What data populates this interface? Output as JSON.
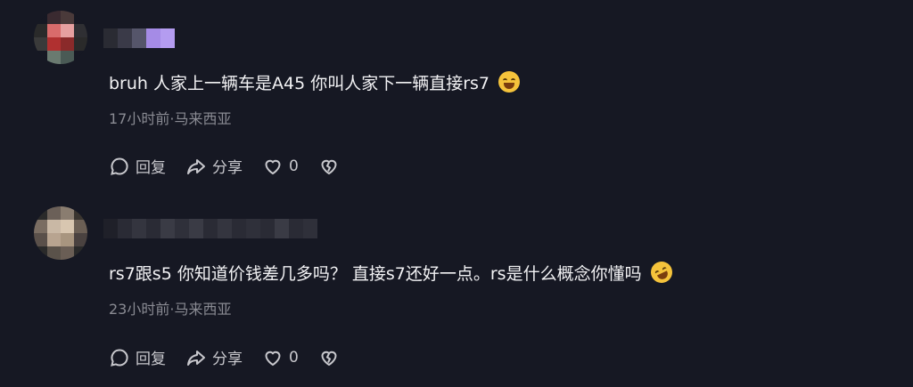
{
  "comments": [
    {
      "text": "bruh 人家上一辆车是A45 你叫人家下一辆直接rs7",
      "emoji": "crying-laughing-emoji",
      "meta": "17小时前·马来西亚",
      "actions": {
        "reply": "回复",
        "share": "分享",
        "likes": "0"
      },
      "avatar_colors": [
        "#161823",
        "#3a2a30",
        "#4a3a3a",
        "#161823",
        "#2a2a2a",
        "#d96b6b",
        "#e6a0a0",
        "#2f2f33",
        "#3a3a3a",
        "#b03030",
        "#8a2a2a",
        "#2a2a2a",
        "#161823",
        "#6a7a70",
        "#4a5a55",
        "#161823"
      ],
      "name_colors": [
        "#2a2b33",
        "#3a3a48",
        "#55556a",
        "#a58be6",
        "#b49cf0"
      ]
    },
    {
      "text": "rs7跟s5 你知道价钱差几多吗？ 直接s7还好一点。rs是什么概念你懂吗",
      "emoji": "rolling-laughing-emoji",
      "meta": "23小时前·马来西亚",
      "actions": {
        "reply": "回复",
        "share": "分享",
        "likes": "0"
      },
      "avatar_colors": [
        "#2a2a2a",
        "#6b6058",
        "#8a7d70",
        "#3a3530",
        "#7a6d62",
        "#c9b8a5",
        "#d8c6b0",
        "#6b5f55",
        "#5a504a",
        "#b8a490",
        "#a8957f",
        "#4a4240",
        "#2a2a2a",
        "#5a524a",
        "#6a5e55",
        "#2a2a2a"
      ],
      "name_colors": [
        "#1f2029",
        "#2a2b35",
        "#34353f",
        "#2a2b35",
        "#3a3b45",
        "#2f303a",
        "#3a3b45",
        "#2a2b35",
        "#34353f",
        "#2a2b35",
        "#2f303a",
        "#2a2b35",
        "#3a3b45",
        "#2a2b35",
        "#2f303a"
      ]
    }
  ]
}
